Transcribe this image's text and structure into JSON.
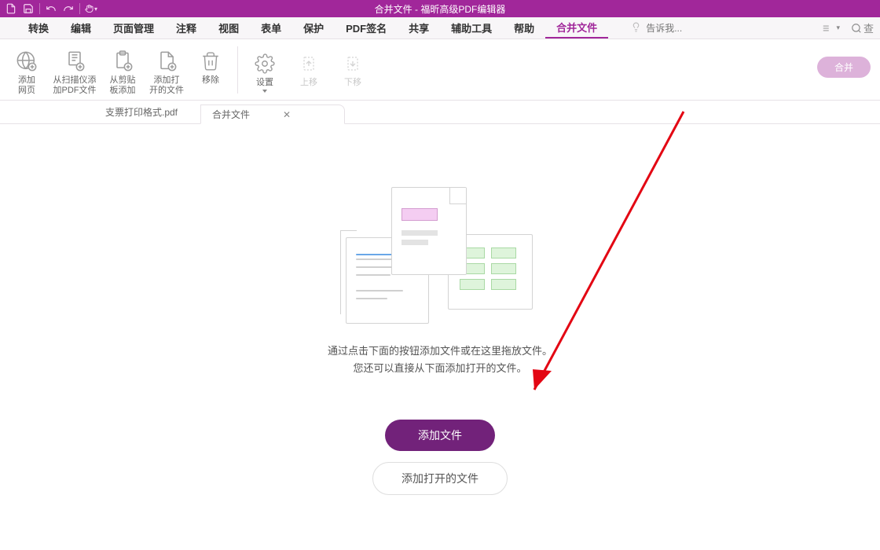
{
  "titlebar": {
    "title": "合并文件 - 福昕高级PDF编辑器"
  },
  "menubar": {
    "items": [
      "转换",
      "编辑",
      "页面管理",
      "注释",
      "视图",
      "表单",
      "保护",
      "PDF签名",
      "共享",
      "辅助工具",
      "帮助",
      "合并文件"
    ],
    "active_index": 11,
    "search_placeholder": "告诉我..."
  },
  "ribbon": {
    "buttons": [
      {
        "label": "添加\n网页",
        "icon": "globe-plus-icon",
        "disabled": false
      },
      {
        "label": "从扫描仪添\n加PDF文件",
        "icon": "scanner-plus-icon",
        "disabled": false
      },
      {
        "label": "从剪贴\n板添加",
        "icon": "clipboard-plus-icon",
        "disabled": false
      },
      {
        "label": "添加打\n开的文件",
        "icon": "file-plus-icon",
        "disabled": false
      },
      {
        "label": "移除",
        "icon": "trash-icon",
        "disabled": false
      }
    ],
    "settings_label": "设置",
    "move_up_label": "上移",
    "move_down_label": "下移",
    "merge_button": "合并"
  },
  "tabs": {
    "items": [
      {
        "label": "支票打印格式.pdf",
        "active": false
      },
      {
        "label": "合并文件",
        "active": true,
        "closable": true
      }
    ]
  },
  "content": {
    "caption_line1": "通过点击下面的按钮添加文件或在这里拖放文件。",
    "caption_line2": "您还可以直接从下面添加打开的文件。",
    "primary_button": "添加文件",
    "secondary_button": "添加打开的文件"
  },
  "right_ctrl_search_label": "查"
}
